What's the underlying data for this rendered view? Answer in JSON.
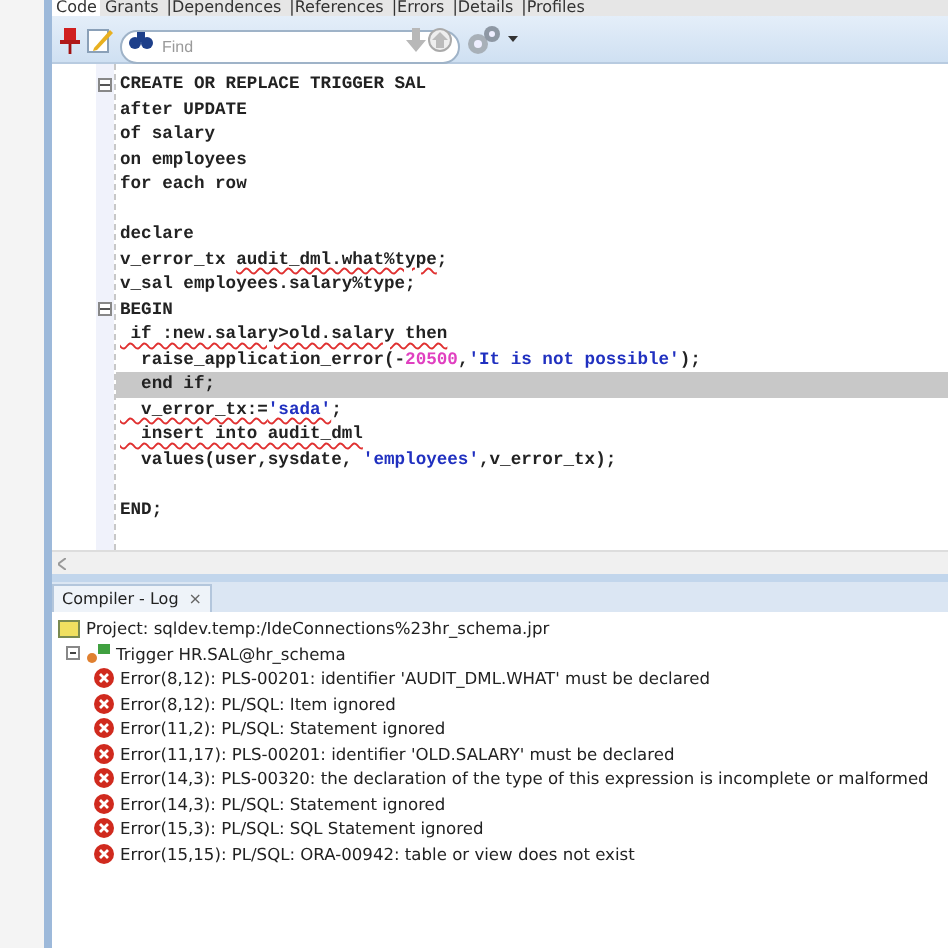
{
  "tabs": [
    {
      "label": "Code",
      "selected": true
    },
    {
      "label": "Grants",
      "selected": false
    },
    {
      "label": "|Dependences",
      "selected": false
    },
    {
      "label": "|References",
      "selected": false
    },
    {
      "label": "|Errors",
      "selected": false
    },
    {
      "label": "|Details",
      "selected": false
    },
    {
      "label": "|Profiles",
      "selected": false
    }
  ],
  "search": {
    "placeholder": "Find"
  },
  "code_lines": [
    {
      "fold": true,
      "highlighted": false,
      "segments": [
        {
          "text": "CREATE OR REPLACE TRIGGER SAL",
          "kind": "plain",
          "error": false
        }
      ]
    },
    {
      "fold": false,
      "highlighted": false,
      "segments": [
        {
          "text": "after UPDATE",
          "kind": "plain",
          "error": false
        }
      ]
    },
    {
      "fold": false,
      "highlighted": false,
      "segments": [
        {
          "text": "of salary",
          "kind": "plain",
          "error": false
        }
      ]
    },
    {
      "fold": false,
      "highlighted": false,
      "segments": [
        {
          "text": "on employees",
          "kind": "plain",
          "error": false
        }
      ]
    },
    {
      "fold": false,
      "highlighted": false,
      "segments": [
        {
          "text": "for each row",
          "kind": "plain",
          "error": false
        }
      ]
    },
    {
      "fold": false,
      "highlighted": false
    },
    {
      "fold": false,
      "highlighted": false,
      "segments": [
        {
          "text": "declare",
          "kind": "plain",
          "error": false
        }
      ]
    },
    {
      "fold": false,
      "highlighted": false,
      "segments": [
        {
          "text": "v_error_tx ",
          "kind": "plain",
          "error": false
        },
        {
          "text": "audit_dml.what%type",
          "kind": "plain",
          "error": true
        },
        {
          "text": ";",
          "kind": "plain",
          "error": false
        }
      ]
    },
    {
      "fold": false,
      "highlighted": false,
      "segments": [
        {
          "text": "v_sal employees.salary%type;",
          "kind": "plain",
          "error": false
        }
      ]
    },
    {
      "fold": true,
      "highlighted": false,
      "segments": [
        {
          "text": "BEGIN",
          "kind": "plain",
          "error": false
        }
      ]
    },
    {
      "fold": false,
      "highlighted": false,
      "segments": [
        {
          "text": " if :new.salary>old.salary then",
          "kind": "plain",
          "error": true
        }
      ]
    },
    {
      "fold": false,
      "highlighted": false,
      "segments": [
        {
          "text": "  raise_application_error(-",
          "kind": "plain",
          "error": false
        },
        {
          "text": "20500",
          "kind": "number",
          "error": false
        },
        {
          "text": ",",
          "kind": "plain",
          "error": false
        },
        {
          "text": "'It is not possible'",
          "kind": "string",
          "error": false
        },
        {
          "text": ");",
          "kind": "plain",
          "error": false
        }
      ]
    },
    {
      "fold": false,
      "highlighted": true,
      "segments": [
        {
          "text": "  end if;",
          "kind": "plain",
          "error": false
        }
      ]
    },
    {
      "fold": false,
      "highlighted": false,
      "segments": [
        {
          "text": "  v_error_tx:=",
          "kind": "plain",
          "error": true
        },
        {
          "text": "'sada'",
          "kind": "string",
          "error": true
        },
        {
          "text": ";",
          "kind": "plain",
          "error": false
        }
      ]
    },
    {
      "fold": false,
      "highlighted": false,
      "segments": [
        {
          "text": "  insert into audit_dml",
          "kind": "plain",
          "error": true
        }
      ]
    },
    {
      "fold": false,
      "highlighted": false,
      "segments": [
        {
          "text": "  values(user,sysdate, ",
          "kind": "plain",
          "error": false
        },
        {
          "text": "'employees'",
          "kind": "string",
          "error": false
        },
        {
          "text": ",v_error_tx);",
          "kind": "plain",
          "error": false
        }
      ]
    },
    {
      "fold": false,
      "highlighted": false
    },
    {
      "fold": false,
      "highlighted": false,
      "segments": [
        {
          "text": "END;",
          "kind": "plain",
          "error": false
        }
      ]
    }
  ],
  "log": {
    "tab": "Compiler - Log",
    "close": "×",
    "project": "Project: sqldev.temp:/IdeConnections%23hr_schema.jpr",
    "trigger": {
      "label": "Trigger HR.SAL@hr_schema",
      "expanded": true,
      "children": [
        {
          "text": "Error(8,12): PLS-00201: identifier 'AUDIT_DML.WHAT' must be declared"
        },
        {
          "text": "Error(8,12): PL/SQL: Item ignored"
        },
        {
          "text": "Error(11,2): PL/SQL: Statement ignored"
        },
        {
          "text": "Error(11,17): PLS-00201: identifier 'OLD.SALARY' must be declared"
        },
        {
          "text": "Error(14,3): PLS-00320: the declaration of the type of this expression is incomplete or malformed"
        },
        {
          "text": "Error(14,3): PL/SQL: Statement ignored"
        },
        {
          "text": "Error(15,3): PL/SQL: SQL Statement ignored"
        },
        {
          "text": "Error(15,15): PL/SQL: ORA-00942: table or view does not exist"
        }
      ]
    }
  }
}
